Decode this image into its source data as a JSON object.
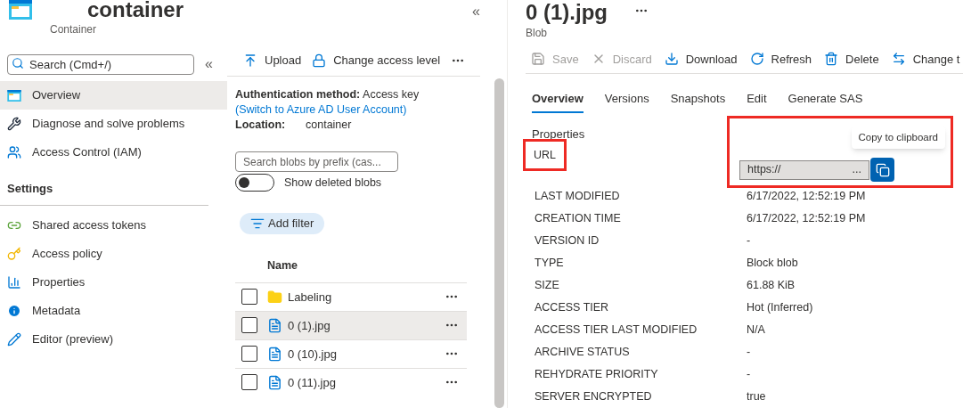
{
  "resource": {
    "title": "container",
    "subtitle": "Container"
  },
  "sidebar": {
    "search": {
      "placeholder": "Search (Cmd+/)"
    },
    "collapse": "«",
    "items": [
      {
        "label": "Overview",
        "selected": true
      },
      {
        "label": "Diagnose and solve problems",
        "selected": false
      },
      {
        "label": "Access Control (IAM)",
        "selected": false
      }
    ],
    "sections": [
      {
        "title": "Settings",
        "items": [
          {
            "label": "Shared access tokens",
            "selected": false
          },
          {
            "label": "Access policy",
            "selected": false
          },
          {
            "label": "Properties",
            "selected": false
          },
          {
            "label": "Metadata",
            "selected": false
          },
          {
            "label": "Editor (preview)",
            "selected": false
          }
        ]
      }
    ]
  },
  "blob_list": {
    "collapse": "«",
    "toolbar": [
      {
        "label": "Upload"
      },
      {
        "label": "Change access level"
      }
    ],
    "auth_label": "Authentication method:",
    "auth_value": "Access key",
    "auth_link": "(Switch to Azure AD User Account)",
    "location_label": "Location:",
    "location_value": "container",
    "search": {
      "placeholder": "Search blobs by prefix (cas..."
    },
    "show_deleted": {
      "label": "Show deleted blobs",
      "on": false
    },
    "add_filter": "Add filter",
    "column": "Name",
    "rows": [
      {
        "name": "Labeling",
        "kind": "folder",
        "selected": false,
        "checked": false
      },
      {
        "name": "0 (1).jpg",
        "kind": "file",
        "selected": true,
        "checked": false
      },
      {
        "name": "0 (10).jpg",
        "kind": "file",
        "selected": false,
        "checked": false
      },
      {
        "name": "0 (11).jpg",
        "kind": "file",
        "selected": false,
        "checked": false
      }
    ]
  },
  "blob": {
    "title": "0 (1).jpg",
    "subtitle": "Blob",
    "toolbar": [
      {
        "label": "Save",
        "disabled": true
      },
      {
        "label": "Discard",
        "disabled": true
      },
      {
        "label": "Download",
        "disabled": false
      },
      {
        "label": "Refresh",
        "disabled": false
      },
      {
        "label": "Delete",
        "disabled": false
      },
      {
        "label": "Change t",
        "disabled": false
      }
    ],
    "tabs": [
      {
        "label": "Overview",
        "selected": true
      },
      {
        "label": "Versions",
        "selected": false
      },
      {
        "label": "Snapshots",
        "selected": false
      },
      {
        "label": "Edit",
        "selected": false
      },
      {
        "label": "Generate SAS",
        "selected": false
      }
    ],
    "section": "Properties",
    "url": {
      "label": "URL",
      "value": "https://",
      "ellipsis": "...",
      "tooltip": "Copy to clipboard",
      "highlighted": true
    },
    "properties": [
      {
        "label": "LAST MODIFIED",
        "value": "6/17/2022, 12:52:19 PM"
      },
      {
        "label": "CREATION TIME",
        "value": "6/17/2022, 12:52:19 PM"
      },
      {
        "label": "VERSION ID",
        "value": "-"
      },
      {
        "label": "TYPE",
        "value": "Block blob"
      },
      {
        "label": "SIZE",
        "value": "61.88 KiB"
      },
      {
        "label": "ACCESS TIER",
        "value": "Hot (Inferred)"
      },
      {
        "label": "ACCESS TIER LAST MODIFIED",
        "value": "N/A"
      },
      {
        "label": "ARCHIVE STATUS",
        "value": "-"
      },
      {
        "label": "REHYDRATE PRIORITY",
        "value": "-"
      },
      {
        "label": "SERVER ENCRYPTED",
        "value": "true"
      }
    ]
  }
}
